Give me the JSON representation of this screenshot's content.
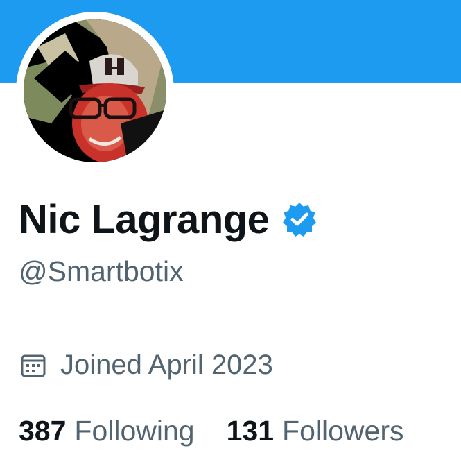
{
  "profile": {
    "display_name": "Nic Lagrange",
    "handle": "@Smartbotix",
    "verified": true,
    "joined": "Joined April 2023",
    "following_count": "387",
    "following_label": "Following",
    "followers_count": "131",
    "followers_label": "Followers"
  },
  "icons": {
    "verified": "verified-badge-icon",
    "joined": "calendar-icon"
  },
  "colors": {
    "banner": "#1d9bf0",
    "verified_badge": "#1d9bf0",
    "primary_text": "#0f1419",
    "secondary_text": "#536471",
    "background": "#ffffff"
  }
}
